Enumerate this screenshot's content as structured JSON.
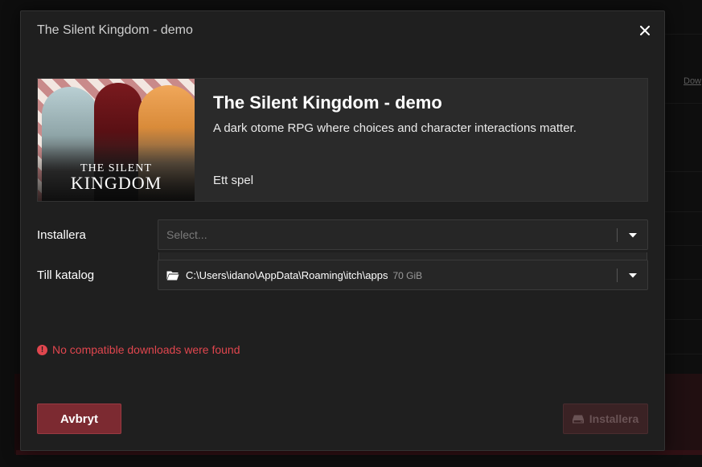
{
  "background": {
    "side_link": "Dow"
  },
  "modal": {
    "title": "The Silent Kingdom - demo",
    "close_icon": "close-icon"
  },
  "game": {
    "name": "The Silent Kingdom - demo",
    "description": "A dark otome RPG where choices and character interactions matter.",
    "type": "Ett spel",
    "cover_logo_small": "THE SILENT",
    "cover_logo_big": "KINGDOM"
  },
  "install": {
    "label": "Installera",
    "placeholder": "Select...",
    "arrow_icon": "chevron-down-icon"
  },
  "directory": {
    "label": "Till katalog",
    "path": "C:\\Users\\idano\\AppData\\Roaming\\itch\\apps",
    "free_space": "70 GiB",
    "folder_icon": "folder-icon"
  },
  "error": {
    "icon": "exclamation-circle-icon",
    "message": "No compatible downloads were found"
  },
  "buttons": {
    "cancel": "Avbryt",
    "install": "Installera",
    "install_icon": "hdd-icon"
  },
  "colors": {
    "modal_bg": "#1f1f1f",
    "accent": "#7c2a31",
    "error": "#e0464e",
    "disabled_button": "#3a2224"
  }
}
